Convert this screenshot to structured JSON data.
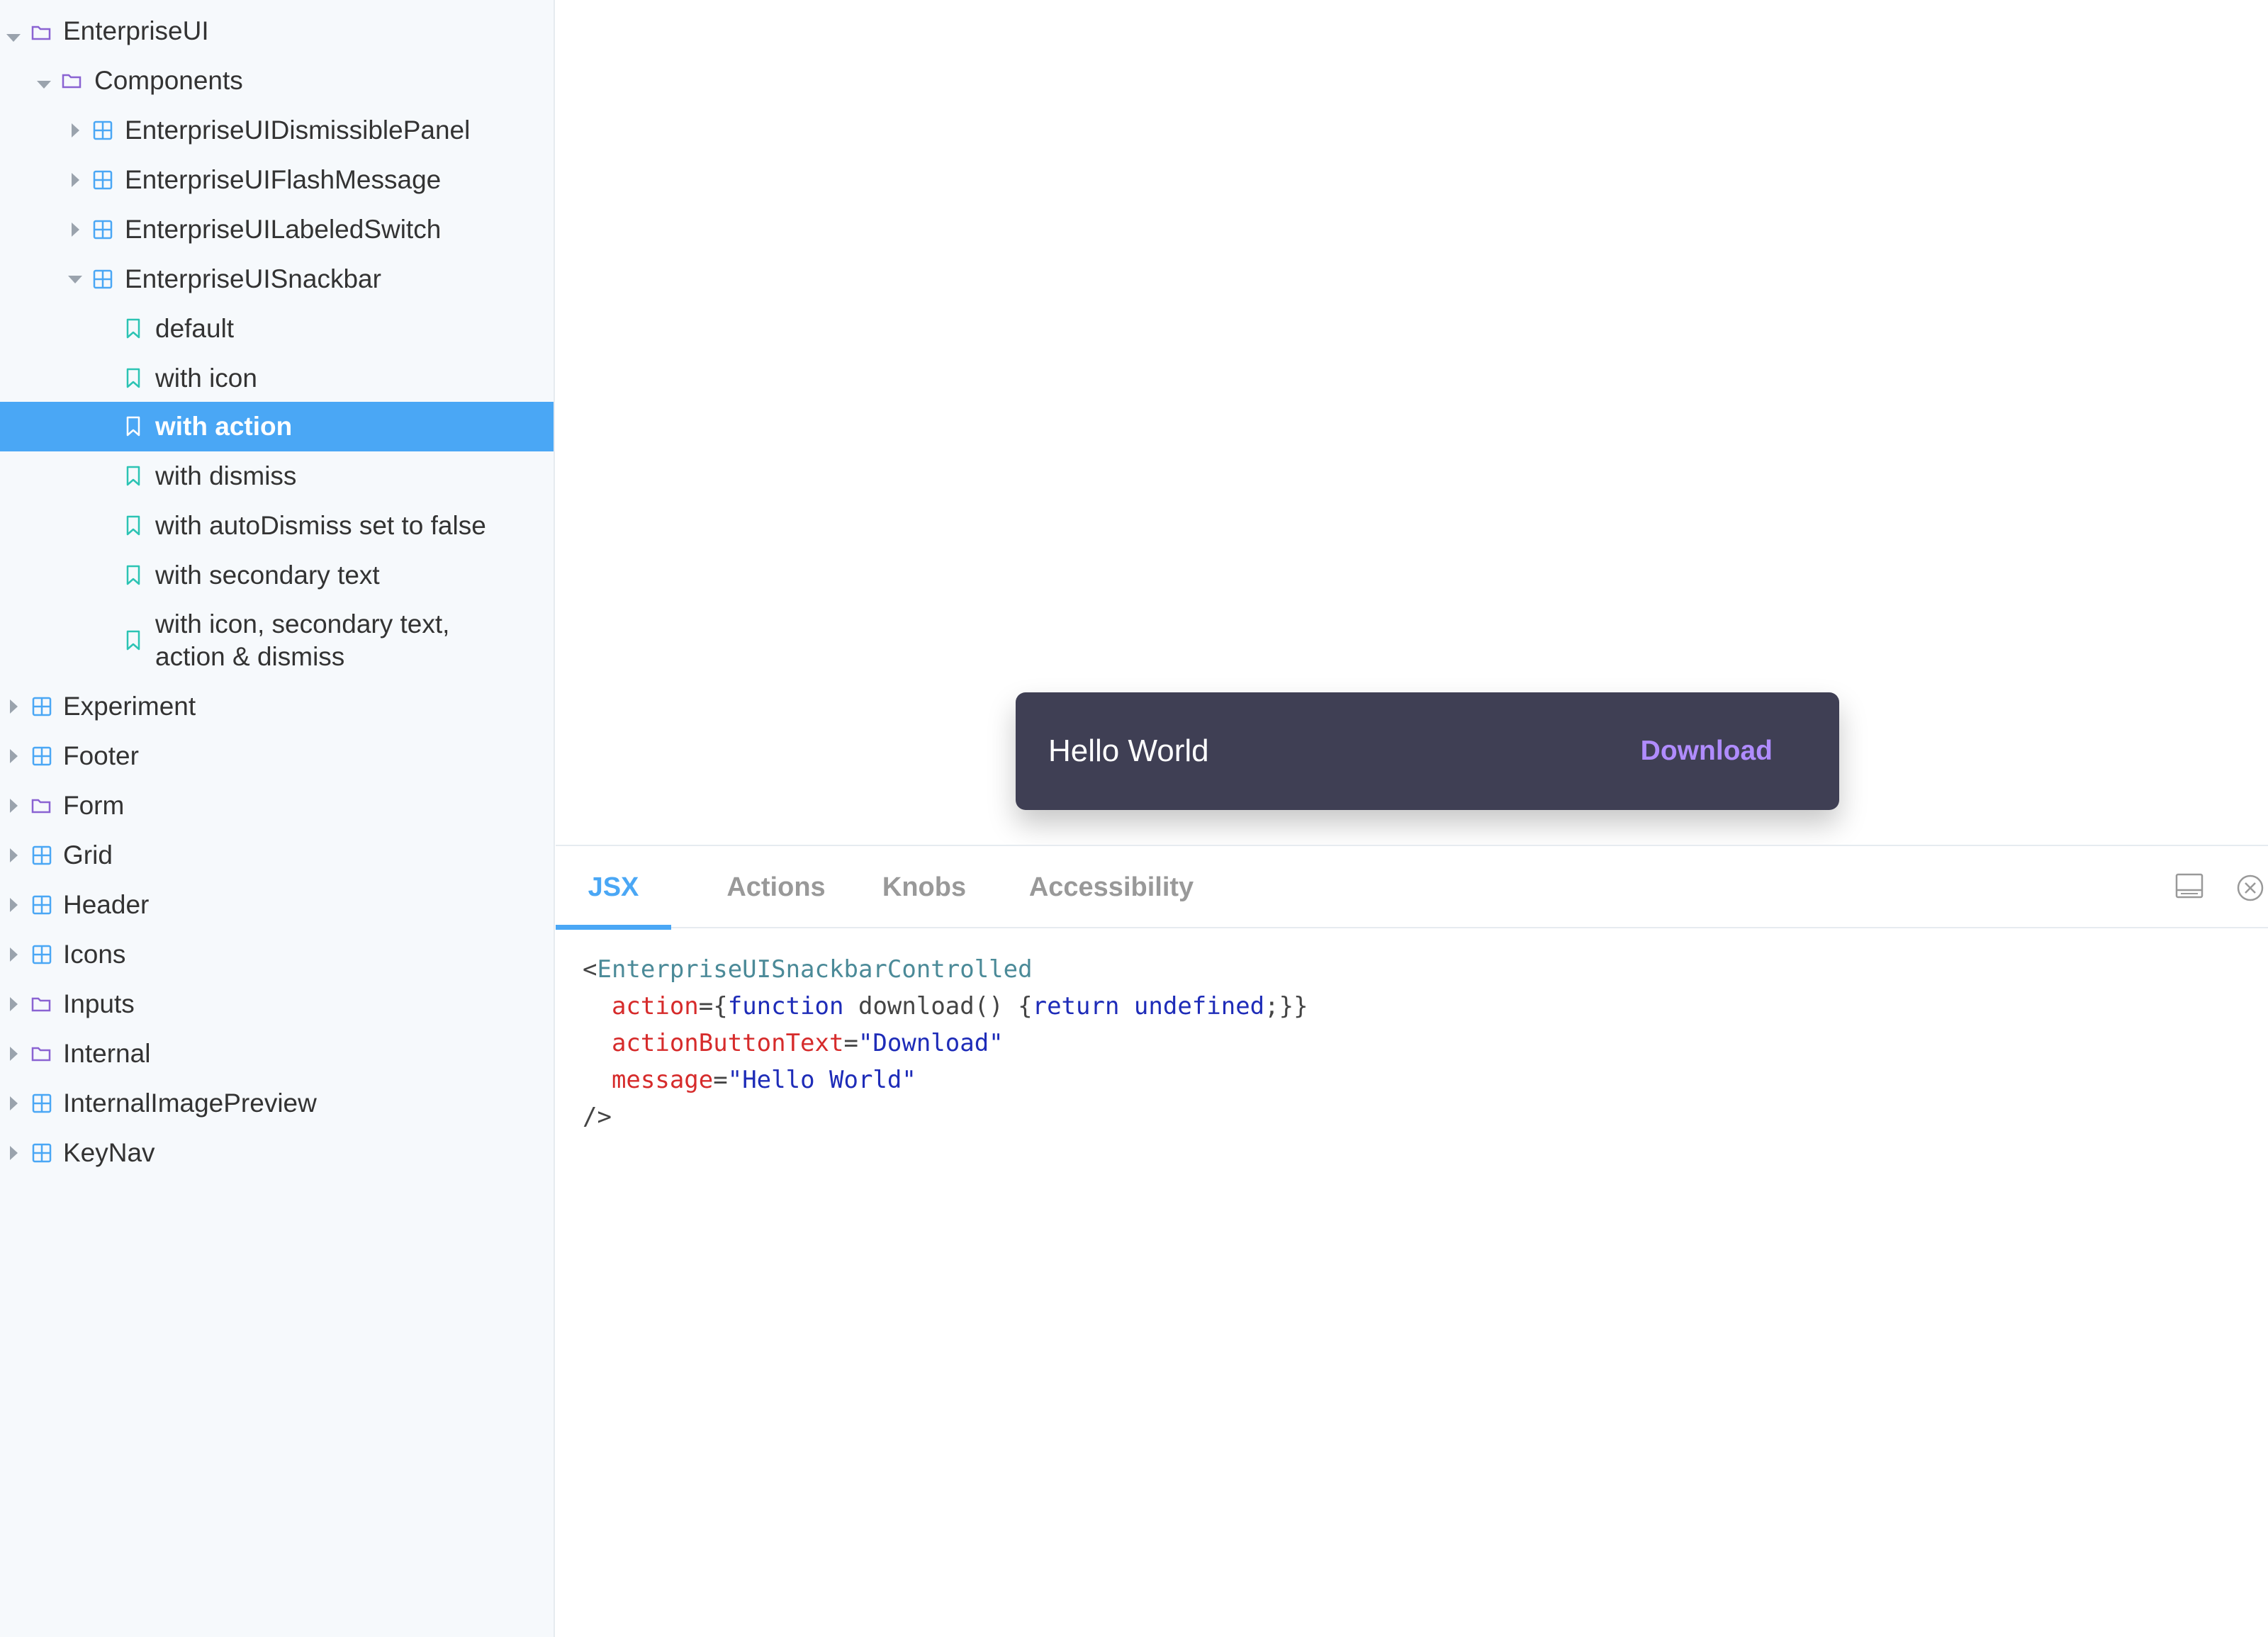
{
  "sidebar": {
    "items": [
      {
        "label": "EnterpriseUI",
        "type": "folder",
        "expanded": true
      },
      {
        "label": "Components",
        "type": "folder",
        "expanded": true
      },
      {
        "label": "EnterpriseUIDismissiblePanel",
        "type": "component",
        "expanded": false
      },
      {
        "label": "EnterpriseUIFlashMessage",
        "type": "component",
        "expanded": false
      },
      {
        "label": "EnterpriseUILabeledSwitch",
        "type": "component",
        "expanded": false
      },
      {
        "label": "EnterpriseUISnackbar",
        "type": "component",
        "expanded": true
      },
      {
        "label": "default",
        "type": "story"
      },
      {
        "label": "with icon",
        "type": "story"
      },
      {
        "label": "with action",
        "type": "story",
        "selected": true
      },
      {
        "label": "with dismiss",
        "type": "story"
      },
      {
        "label": "with autoDismiss set to false",
        "type": "story"
      },
      {
        "label": "with secondary text",
        "type": "story"
      },
      {
        "label": "with icon, secondary text, action & dismiss",
        "type": "story"
      },
      {
        "label": "Experiment",
        "type": "component",
        "expanded": false
      },
      {
        "label": "Footer",
        "type": "component",
        "expanded": false
      },
      {
        "label": "Form",
        "type": "folder",
        "expanded": false
      },
      {
        "label": "Grid",
        "type": "component",
        "expanded": false
      },
      {
        "label": "Header",
        "type": "component",
        "expanded": false
      },
      {
        "label": "Icons",
        "type": "component",
        "expanded": false
      },
      {
        "label": "Inputs",
        "type": "folder",
        "expanded": false
      },
      {
        "label": "Internal",
        "type": "folder",
        "expanded": false
      },
      {
        "label": "InternalImagePreview",
        "type": "component",
        "expanded": false
      },
      {
        "label": "KeyNav",
        "type": "component",
        "expanded": false
      }
    ]
  },
  "preview": {
    "snackbar": {
      "message": "Hello World",
      "action_label": "Download"
    }
  },
  "panel": {
    "tabs": [
      {
        "label": "JSX",
        "active": true
      },
      {
        "label": "Actions",
        "active": false
      },
      {
        "label": "Knobs",
        "active": false
      },
      {
        "label": "Accessibility",
        "active": false
      }
    ],
    "code": {
      "open_bracket": "<",
      "component": "EnterpriseUISnackbarControlled",
      "attr_action": "action",
      "eq_brace": "={",
      "kw_function": "function",
      "fn_sig": " download() {",
      "kw_return": "return",
      "kw_undefined": "undefined",
      "fn_end": ";}}",
      "attr_action_text": "actionButtonText",
      "val_action_text": "\"Download\"",
      "attr_message": "message",
      "val_message": "\"Hello World\"",
      "eq": "=",
      "close": "/>"
    }
  },
  "icons": {
    "panel_toggle": "panel-bottom-icon",
    "panel_close": "close-circle-icon"
  },
  "colors": {
    "accent": "#4aa7f5",
    "folder_icon": "#8a63d2",
    "component_icon": "#4aa7f5",
    "story_icon": "#2cc4b4",
    "snackbar_bg": "#3f3f54",
    "snackbar_action": "#b08cff"
  }
}
